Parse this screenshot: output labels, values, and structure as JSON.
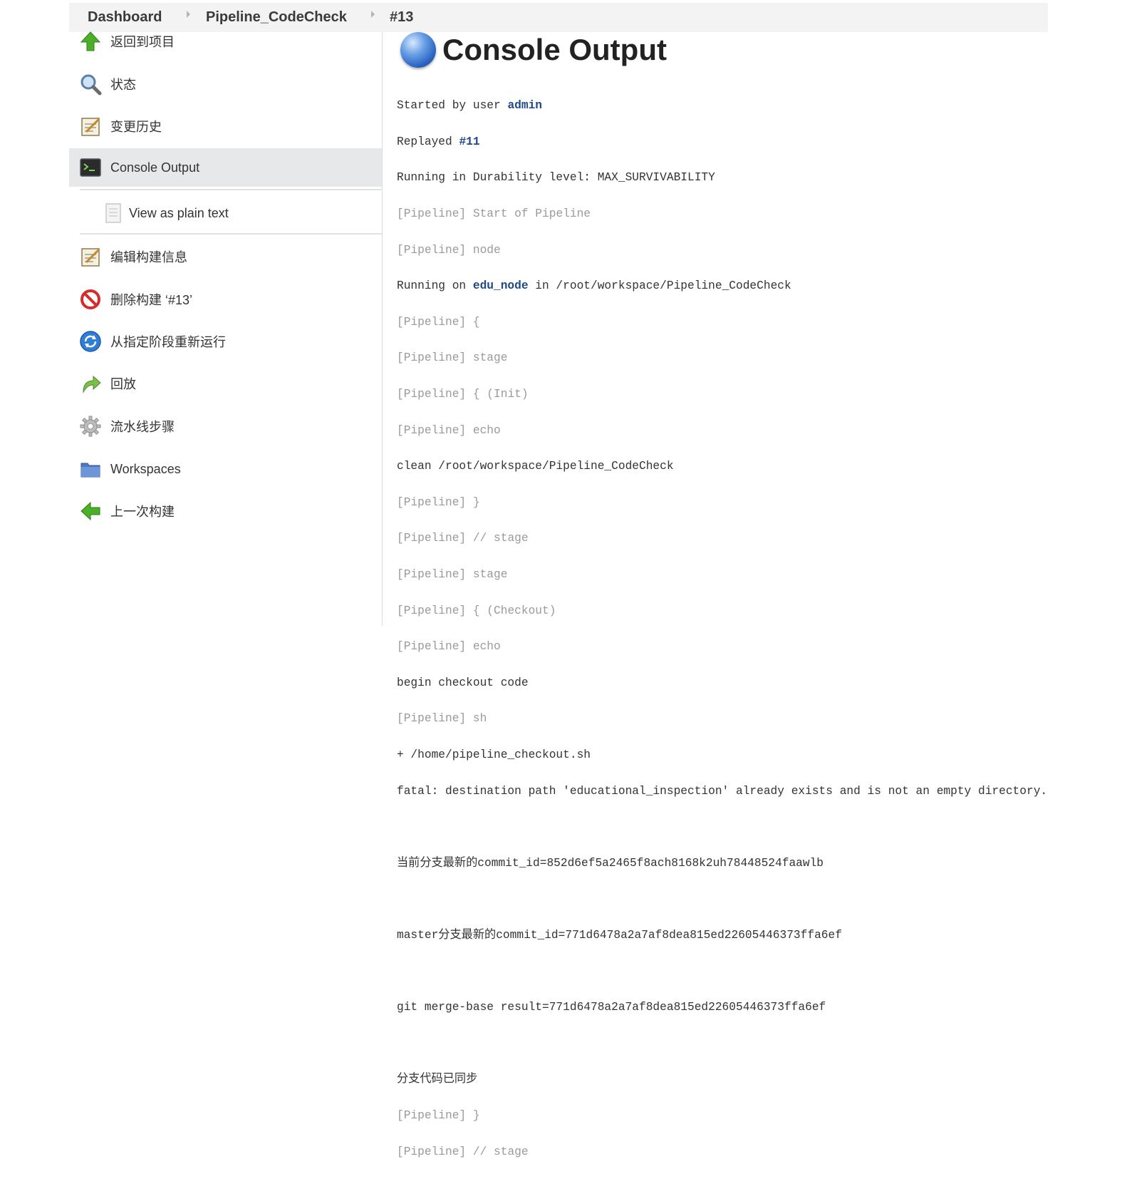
{
  "breadcrumb": {
    "items": [
      "Dashboard",
      "Pipeline_CodeCheck",
      "#13"
    ]
  },
  "sidebar": {
    "items": [
      {
        "label": "返回到项目",
        "icon": "up-arrow-icon"
      },
      {
        "label": "状态",
        "icon": "magnifier-icon"
      },
      {
        "label": "变更历史",
        "icon": "notepad-icon"
      },
      {
        "label": "Console Output",
        "icon": "terminal-icon",
        "active": true
      },
      {
        "label": "View as plain text",
        "icon": "document-icon"
      },
      {
        "label": "编辑构建信息",
        "icon": "notepad-edit-icon"
      },
      {
        "label": "删除构建 ‘#13’",
        "icon": "no-entry-icon"
      },
      {
        "label": "从指定阶段重新运行",
        "icon": "refresh-icon"
      },
      {
        "label": "回放",
        "icon": "replay-arrow-icon"
      },
      {
        "label": "流水线步骤",
        "icon": "gear-icon"
      },
      {
        "label": "Workspaces",
        "icon": "folder-icon"
      },
      {
        "label": "上一次构建",
        "icon": "left-arrow-icon"
      }
    ]
  },
  "main": {
    "title": "Console Output",
    "console": {
      "started_prefix": "Started by user ",
      "started_user": "admin",
      "replayed_prefix": "Replayed ",
      "replayed_build": "#11",
      "durability": "Running in Durability level: MAX_SURVIVABILITY",
      "pl": "[Pipeline]",
      "start_of_pipeline": " Start of Pipeline",
      "node": " node",
      "running_on_prefix": "Running on ",
      "running_on_node": "edu_node",
      "running_on_suffix": " in /root/workspace/Pipeline_CodeCheck",
      "open_brace": " {",
      "stage": " stage",
      "open_init": " { (Init)",
      "echo": " echo",
      "clean": "clean /root/workspace/Pipeline_CodeCheck",
      "close_brace": " }",
      "comment_stage": " // stage",
      "open_checkout": " { (Checkout)",
      "begin_checkout": "begin checkout code",
      "sh": " sh",
      "sh_cmd": "+ /home/pipeline_checkout.sh",
      "fatal": "fatal: destination path 'educational_inspection' already exists and is not an empty directory.",
      "current_commit": "当前分支最新的commit_id=852d6ef5a2465f8ach8168k2uh78448524faawlb",
      "master_commit": "master分支最新的commit_id=771d6478a2a7af8dea815ed22605446373ffa6ef",
      "merge_base": "git merge-base result=771d6478a2a7af8dea815ed22605446373ffa6ef",
      "synced": "分支代码已同步"
    }
  }
}
